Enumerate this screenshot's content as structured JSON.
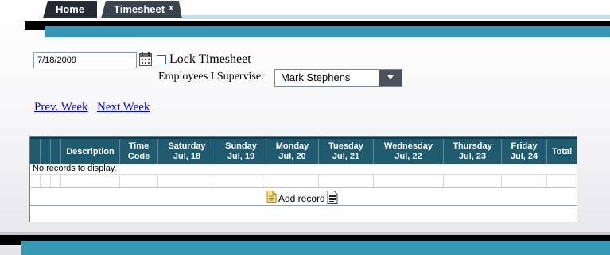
{
  "tabs": [
    {
      "label": "Home"
    },
    {
      "label": "Timesheet",
      "close": "x"
    }
  ],
  "form": {
    "date_value": "7/18/2009",
    "lock_label": "Lock Timesheet",
    "lock_checked": false,
    "supervise_label": "Employees I Supervise:",
    "supervise_selected": "Mark Stephens"
  },
  "nav": {
    "prev_week": "Prev. Week",
    "next_week": "Next Week"
  },
  "grid": {
    "columns": [
      {
        "line1": "",
        "line2": ""
      },
      {
        "line1": "",
        "line2": ""
      },
      {
        "line1": "",
        "line2": ""
      },
      {
        "line1": "Description",
        "line2": ""
      },
      {
        "line1": "Time",
        "line2": "Code"
      },
      {
        "line1": "Saturday",
        "line2": "Jul, 18"
      },
      {
        "line1": "Sunday",
        "line2": "Jul, 19"
      },
      {
        "line1": "Monday",
        "line2": "Jul, 20"
      },
      {
        "line1": "Tuesday",
        "line2": "Jul, 21"
      },
      {
        "line1": "Wednesday",
        "line2": "Jul, 22"
      },
      {
        "line1": "Thursday",
        "line2": "Jul, 23"
      },
      {
        "line1": "Friday",
        "line2": "Jul, 24"
      },
      {
        "line1": "Total",
        "line2": ""
      }
    ],
    "no_records": "No records to display.",
    "add_record": "Add record"
  },
  "colors": {
    "header_bg": "#1f5a6e",
    "accent_teal": "#3598b5",
    "tab_dark": "#232a33",
    "link": "#0000ee"
  },
  "icons": [
    "calendar-icon",
    "chevron-down-icon",
    "add-record-icon",
    "export-icon"
  ]
}
